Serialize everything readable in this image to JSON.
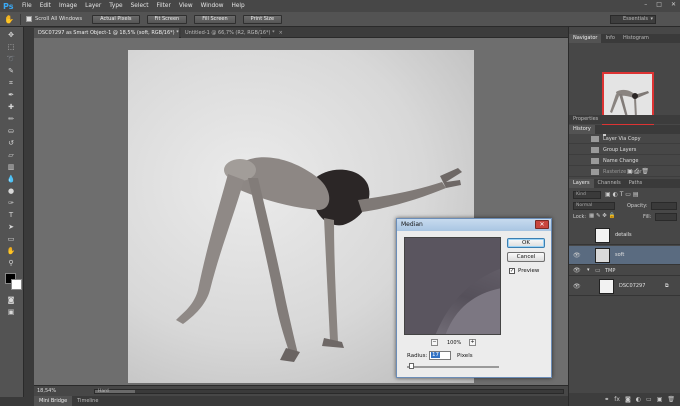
{
  "app": {
    "logo": "Ps"
  },
  "menu": [
    "File",
    "Edit",
    "Image",
    "Layer",
    "Type",
    "Select",
    "Filter",
    "View",
    "Window",
    "Help"
  ],
  "window_controls": [
    "–",
    "□",
    "✕"
  ],
  "options_bar": {
    "scroll_all_label": "Scroll All Windows",
    "buttons": [
      "Actual Pixels",
      "Fit Screen",
      "Fill Screen",
      "Print Size"
    ],
    "workspace": "Essentials"
  },
  "doc_tabs": [
    {
      "title": "DSC07297 as Smart Object-1 @ 18,5% (soft, RGB/16*) *",
      "close": "×"
    },
    {
      "title": "Untitled-1 @ 66,7% (R2, RGB/16*) *",
      "close": "×"
    }
  ],
  "status": {
    "zoom": "18,54%",
    "scroll_label": "Hard"
  },
  "bottom_tabs": [
    "Mini Bridge",
    "Timeline"
  ],
  "navigator": {
    "tabs": [
      "Navigator",
      "Info",
      "Histogram"
    ],
    "zoom": "18,54%"
  },
  "properties": {
    "title": "Properties"
  },
  "history": {
    "title": "History",
    "items": [
      "Layer Via Copy",
      "Group Layers",
      "Name Change",
      "Rasterize Layer"
    ]
  },
  "layers": {
    "tabs": [
      "Layers",
      "Channels",
      "Paths"
    ],
    "filter_kind": "Kind",
    "blend_mode": "Normal",
    "opacity_label": "Opacity:",
    "lock_label": "Lock:",
    "fill_label": "Fill:",
    "items": [
      {
        "name": "details",
        "selected": false,
        "visible": false
      },
      {
        "name": "soft",
        "selected": true,
        "visible": true
      },
      {
        "name": "TMP",
        "selected": false,
        "visible": true,
        "group": true
      },
      {
        "name": "DSC07297",
        "selected": false,
        "visible": true
      }
    ],
    "footer_icons": [
      "link-icon",
      "fx-icon",
      "mask-icon",
      "adjustment-icon",
      "group-icon",
      "new-layer-icon",
      "trash-icon"
    ]
  },
  "dialog": {
    "title": "Median",
    "close": "✕",
    "ok_label": "OK",
    "cancel_label": "Cancel",
    "preview_label": "Preview",
    "preview_checked": "✓",
    "zoom_percent": "100%",
    "zoom_minus": "−",
    "zoom_plus": "+",
    "radius_label": "Radius:",
    "radius_value": "17",
    "pixels_label": "Pixels"
  }
}
